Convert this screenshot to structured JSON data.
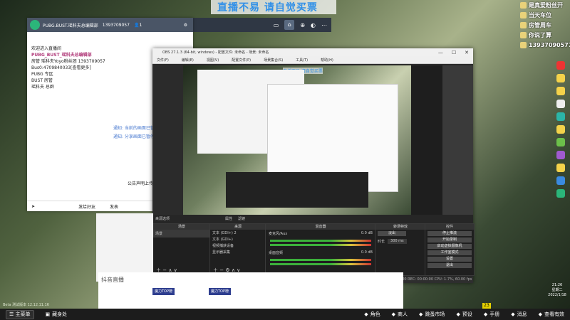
{
  "overlay": {
    "banner": "直播不易 请自觉买票"
  },
  "right_overlay": {
    "rows": [
      {
        "text": "是真爱粉丝开"
      },
      {
        "text": "当天车位"
      },
      {
        "text": "房管周车"
      },
      {
        "text": "你说了算"
      },
      {
        "text": "13937090577"
      }
    ]
  },
  "douyin": {
    "title": "PUBG.BUST.瑶科夫总编辑部",
    "id": "1393709057",
    "count": "1",
    "lines": [
      "欢迎进入直播间",
      "PUBG_BUST_瑶科夫总编辑部",
      "房管 瑶科夫Yoyo粉丝团 1393709057",
      "Bus0:4709840033[查看更多]",
      "PUBG 专区",
      "BUST 房管",
      "瑶科夫 总群"
    ],
    "notice1": "通知: 当前的画面已暂停",
    "notice2": "通知: 分享画面已暂停",
    "bottom_text": "公告声明上传到",
    "bottom_tabs": [
      "发给好友",
      "发表"
    ]
  },
  "obs": {
    "title": "OBS 27.1.3 (64-bit, windows) - 配置文件: 未命名 - 场景: 未命名",
    "menu": [
      "文件(F)",
      "编辑(E)",
      "视图(V)",
      "配置文件(P)",
      "场景集合(S)",
      "工具(T)",
      "帮助(H)"
    ],
    "preview_banner": "直播不易 请自觉买票",
    "tabs": [
      "来源选项",
      "属性",
      "滤镜"
    ],
    "docks": {
      "scenes": {
        "header": "场景",
        "items": [
          "场景"
        ]
      },
      "sources": {
        "header": "来源",
        "items": [
          "文本 (GDI+) 2",
          "文本 (GDI+)",
          "视频捕获设备",
          "显示器采集"
        ]
      },
      "mixer": {
        "header": "混音器",
        "tracks": [
          {
            "name": "麦克风/Aux",
            "db": "0.0 dB"
          },
          {
            "name": "桌面音频",
            "db": "0.0 dB"
          }
        ]
      },
      "transitions": {
        "header": "转场特效",
        "type": "淡出",
        "duration_label": "时长",
        "duration": "300 ms"
      },
      "controls": {
        "header": "控件",
        "buttons": [
          "停止推流",
          "开始录制",
          "启动虚拟摄像机",
          "工作室模式",
          "设置",
          "退出"
        ]
      }
    },
    "status": "LIVE: 00:00:00  REC: 00:00:00  CPU: 1.7%, 60.00 fps"
  },
  "douyin_lower": {
    "label": "抖音直播",
    "tiles": [
      "魔力TOP榜",
      "魔力TOP榜"
    ]
  },
  "beta_text": "Beta 测试版本 12.12.11.16",
  "clock": {
    "time": "21:26",
    "weekday": "星期二",
    "date": "2022/1/18"
  },
  "taskbar": {
    "start": "主菜单",
    "app": "藏身处",
    "items": [
      {
        "icon": "role-icon",
        "label": "角色"
      },
      {
        "icon": "shop-icon",
        "label": "商人"
      },
      {
        "icon": "market-icon",
        "label": "跳蚤市场"
      },
      {
        "icon": "preset-icon",
        "label": "预设"
      },
      {
        "icon": "manual-icon",
        "label": "手册"
      },
      {
        "icon": "message-icon",
        "label": "消息"
      },
      {
        "icon": "view-icon",
        "label": "查看有效"
      }
    ],
    "badge": "23"
  }
}
